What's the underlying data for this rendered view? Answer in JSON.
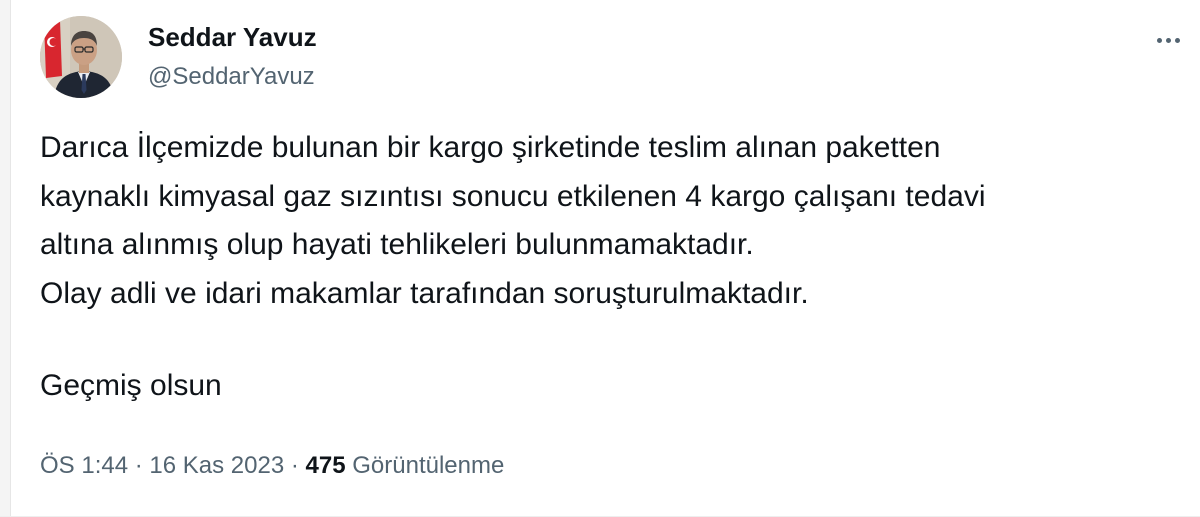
{
  "author": {
    "display_name": "Seddar Yavuz",
    "handle": "@SeddarYavuz"
  },
  "tweet": {
    "lines": [
      "Darıca İlçemizde bulunan bir kargo şirketinde teslim alınan paketten\nkaynaklı kimyasal gaz sızıntısı sonucu etkilenen 4 kargo çalışanı tedavi\naltına alınmış olup hayati tehlikeleri bulunmamaktadır.\nOlay adli ve idari makamlar tarafından soruşturulmaktadır.",
      "Geçmiş olsun"
    ]
  },
  "meta": {
    "time": "ÖS 1:44",
    "separator": "·",
    "date": "16 Kas 2023",
    "views_count": "475",
    "views_label": "Görüntülenme"
  },
  "icons": {
    "more": "more-horizontal-icon"
  },
  "colors": {
    "text": "#0f1419",
    "secondary": "#536471"
  }
}
